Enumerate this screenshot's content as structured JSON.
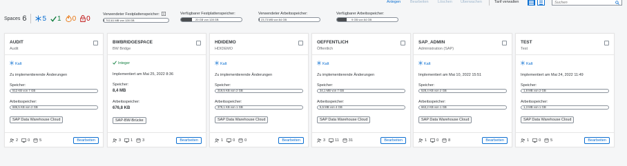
{
  "toolbar": {
    "anlegen": "Anlegen",
    "bearbeiten": "Bearbeiten",
    "loeschen": "Löschen",
    "ueberwachen": "Überwachen",
    "tarif": "Tarif verwalten",
    "search_placeholder": "Suchen",
    "accent": "#0a6ed1"
  },
  "summary": {
    "spaces_label": "Spaces",
    "spaces_count": "6",
    "cold_count": "5",
    "ok_count": "1",
    "hot_count": "0",
    "locked_count": "0",
    "metrics": [
      {
        "title": "Verwendeter Festplattenspeicher:",
        "value": "702,61 MB von 128 GB",
        "fraction": 0.005
      },
      {
        "title": "Verfügbarer Festplattenspeicher:",
        "value": "20 GB von 128 GB",
        "fraction": 0.16
      },
      {
        "title": "Verwendeter Arbeitsspeicher:",
        "value": "23,73 MB von 64 GB",
        "fraction": 0.004
      },
      {
        "title": "Verfügbarer Arbeitsspeicher:",
        "value": "9 GB von 64 GB",
        "fraction": 0.14
      }
    ]
  },
  "labels": {
    "speicher": "Speicher:",
    "arbeitsspeicher": "Arbeitsspeicher:",
    "edit": "Bearbeiten"
  },
  "cards": [
    {
      "name": "AUDIT",
      "sub": "Audit",
      "status": "Kalt",
      "line": "Zu implementierende Änderungen",
      "storage": "512 KB von 7 GB",
      "memory": "686,5 KB von 2 GB",
      "tag": "SAP Data Warehouse Cloud",
      "users": "2",
      "conn": "0",
      "objs": "5"
    },
    {
      "name": "BWBRIDGESPACE",
      "sub": "BW Bridge",
      "status": "Integer",
      "line": "Implementiert am Mai 25, 2022 8:36",
      "storage": "8,4 MB",
      "memory": "676,8 KB",
      "tag": "SAP-BW-Brücke",
      "users": "3",
      "conn": "1",
      "objs": "3"
    },
    {
      "name": "HDIDEMO",
      "sub": "HDIDEMO",
      "status": "Kalt",
      "line": "Zu implementierende Änderungen",
      "storage": "319,5 KB von 2 GB",
      "memory": "379,1 KB von 1 GB",
      "tag": "SAP Data Warehouse Cloud",
      "users": "1",
      "conn": "0",
      "objs": "0"
    },
    {
      "name": "OEFFENTLICH",
      "sub": "Öffentlich",
      "status": "Kalt",
      "line": "Zu implementierende Änderungen",
      "storage": "34,1 MB von 7 GB",
      "memory": "5,5 MB von 4 GB",
      "tag": "SAP Data Warehouse Cloud",
      "users": "3",
      "conn": "11",
      "objs": "31"
    },
    {
      "name": "SAP_ADMIN",
      "sub": "Administration (SAP)",
      "status": "Kalt",
      "line": "Implementiert am Mai 10, 2022 15:51",
      "storage": "528,4 KB von 2 GB",
      "memory": "663,2 KB von 1 GB",
      "tag": "SAP Data Warehouse Cloud",
      "users": "1",
      "conn": "0",
      "objs": "8"
    },
    {
      "name": "TEST",
      "sub": "Test",
      "status": "Kalt",
      "line": "Implementiert am Mai 24, 2022 11:49",
      "storage": "1,8 MB von 2 GB",
      "memory": "1,3 MB von 1 GB",
      "tag": "SAP Data Warehouse Cloud",
      "users": "1",
      "conn": "0",
      "objs": "5"
    }
  ]
}
